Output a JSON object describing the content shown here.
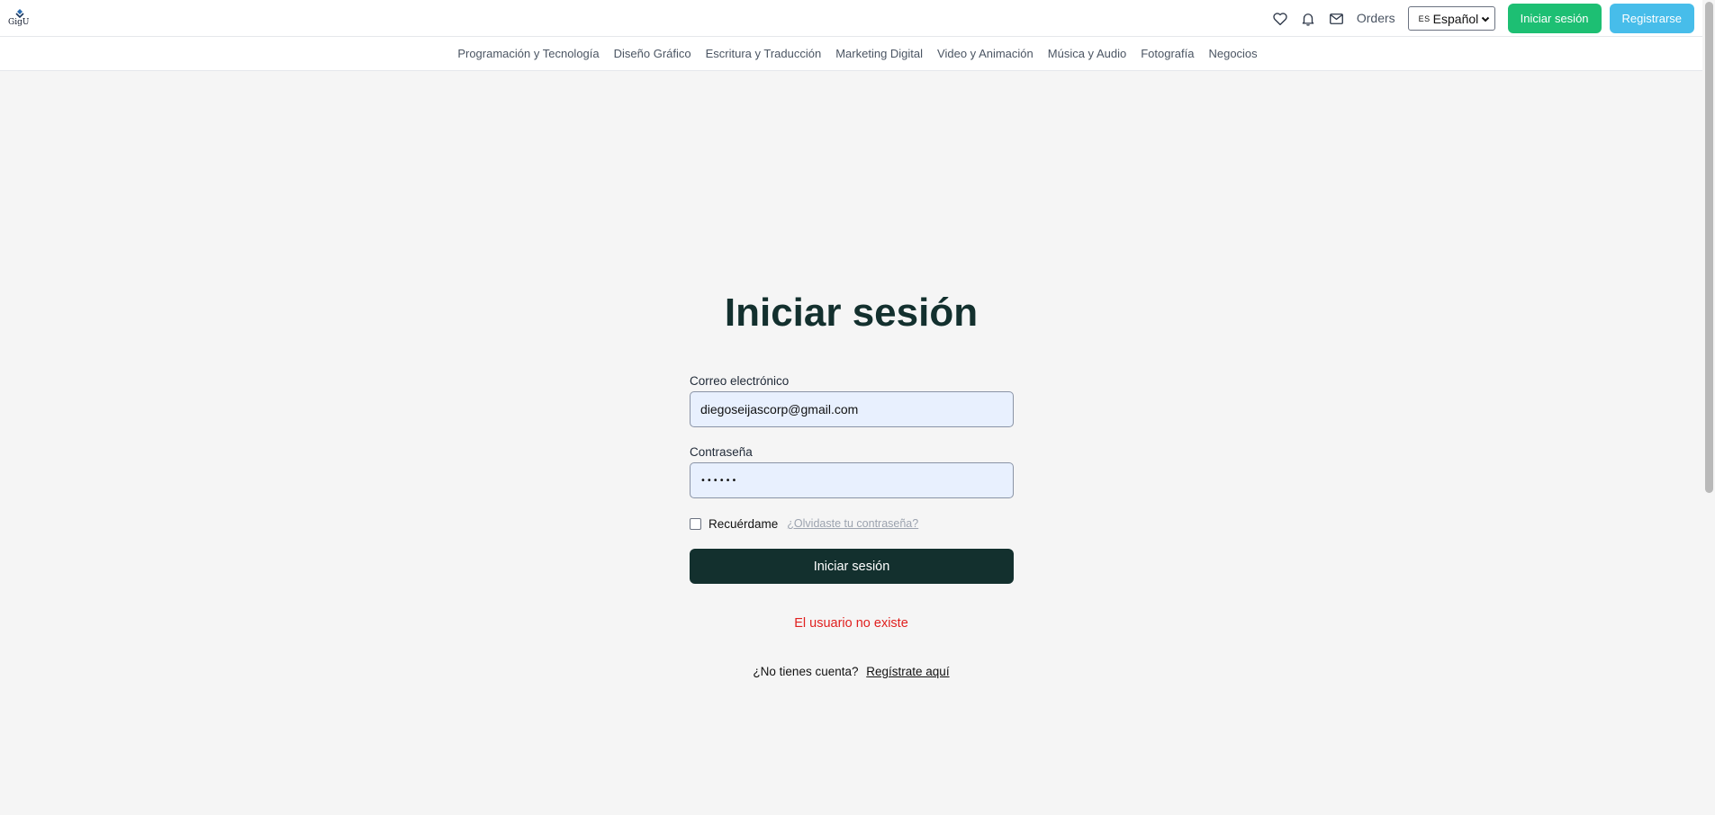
{
  "header": {
    "logo_text": "GigU",
    "orders_label": "Orders",
    "language": {
      "code": "ES",
      "selected": "Español"
    },
    "login_label": "Iniciar sesión",
    "register_label": "Registrarse",
    "icons": [
      "heart-icon",
      "bell-icon",
      "mail-icon"
    ]
  },
  "categories": [
    "Programación y Tecnología",
    "Diseño Gráfico",
    "Escritura y Traducción",
    "Marketing Digital",
    "Video y Animación",
    "Música y Audio",
    "Fotografía",
    "Negocios"
  ],
  "login": {
    "title": "Iniciar sesión",
    "email_label": "Correo electrónico",
    "email_value": "diegoseijascorp@gmail.com",
    "password_label": "Contraseña",
    "password_value": "••••••",
    "remember_label": "Recuérdame",
    "forgot_label": "¿Olvidaste tu contraseña?",
    "submit_label": "Iniciar sesión",
    "error_message": "El usuario no existe",
    "no_account_text": "¿No tienes cuenta?",
    "signup_link": "Regístrate aquí"
  },
  "colors": {
    "brand_dark": "#13302e",
    "login_green": "#1dbf73",
    "register_blue": "#47bdea",
    "error_red": "#e0201f",
    "input_bg": "#e8f0fe"
  }
}
